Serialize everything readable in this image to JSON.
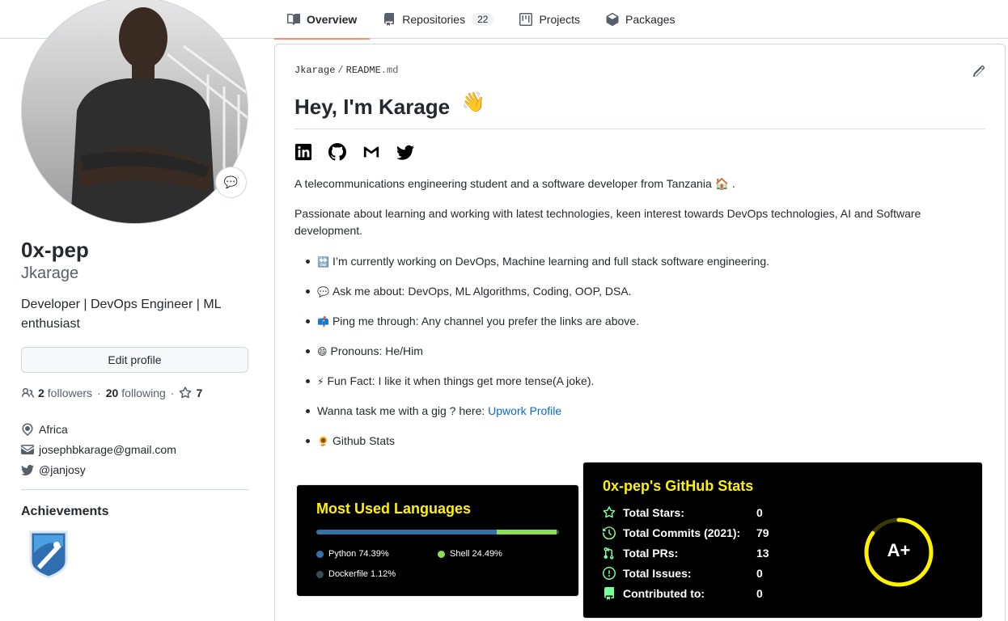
{
  "tabs": [
    {
      "label": "Overview",
      "active": true
    },
    {
      "label": "Repositories",
      "count": "22"
    },
    {
      "label": "Projects"
    },
    {
      "label": "Packages"
    }
  ],
  "profile": {
    "name": "0x-pep",
    "login": "Jkarage",
    "bio": "Developer | DevOps Engineer | ML enthusiast",
    "edit_label": "Edit profile",
    "followers_count": "2",
    "followers_label": "followers",
    "following_count": "20",
    "following_label": "following",
    "stars_count": "7",
    "location": "Africa",
    "email": "josephbkarage@gmail.com",
    "twitter": "@janjosy",
    "achievements_title": "Achievements"
  },
  "readme": {
    "owner": "Jkarage",
    "file": "README",
    "ext": ".md",
    "heading": "Hey, I'm Karage",
    "wave": "👋",
    "intro": "A telecommunications engineering student and a software developer from Tanzania 🏠 .",
    "passion": "Passionate about learning and working with latest technologies, keen interest towards DevOps technologies, AI and Software development.",
    "items": [
      {
        "emoji": "🔛",
        "text": "I’m currently working on DevOps, Machine learning and full stack software engineering."
      },
      {
        "emoji": "💬",
        "text": "Ask me about: DevOps, ML Algorithms, Coding, OOP, DSA."
      },
      {
        "emoji": "📫",
        "text": "Ping me through: Any channel you prefer the links are above."
      },
      {
        "emoji": "😄",
        "text": "Pronouns: He/Him"
      },
      {
        "emoji": "⚡",
        "text": "Fun Fact: I like it when things get more tense(A joke)."
      }
    ],
    "gig_text": "Wanna task me with a gig ? here: ",
    "gig_link": "Upwork Profile",
    "stats_item": {
      "emoji": "🌻",
      "text": "Github Stats"
    }
  },
  "languages_card": {
    "title": "Most Used Languages",
    "langs": [
      {
        "name": "Python",
        "percent": "74.39%",
        "value": 74.39,
        "color": "#3572A5"
      },
      {
        "name": "Shell",
        "percent": "24.49%",
        "value": 24.49,
        "color": "#89e051"
      },
      {
        "name": "Dockerfile",
        "percent": "1.12%",
        "value": 1.12,
        "color": "#384d54"
      }
    ]
  },
  "stats_card": {
    "title": "0x-pep's GitHub Stats",
    "rows": [
      {
        "label": "Total Stars:",
        "value": "0",
        "icon": "star-icon"
      },
      {
        "label": "Total Commits (2021):",
        "value": "79",
        "icon": "history-icon"
      },
      {
        "label": "Total PRs:",
        "value": "13",
        "icon": "pull-request-icon"
      },
      {
        "label": "Total Issues:",
        "value": "0",
        "icon": "issue-icon"
      },
      {
        "label": "Contributed to:",
        "value": "0",
        "icon": "repo-icon"
      }
    ],
    "grade": "A+",
    "grade_ring_fraction": 0.85,
    "accent": "#fff200",
    "icon_color": "#79ff97"
  }
}
